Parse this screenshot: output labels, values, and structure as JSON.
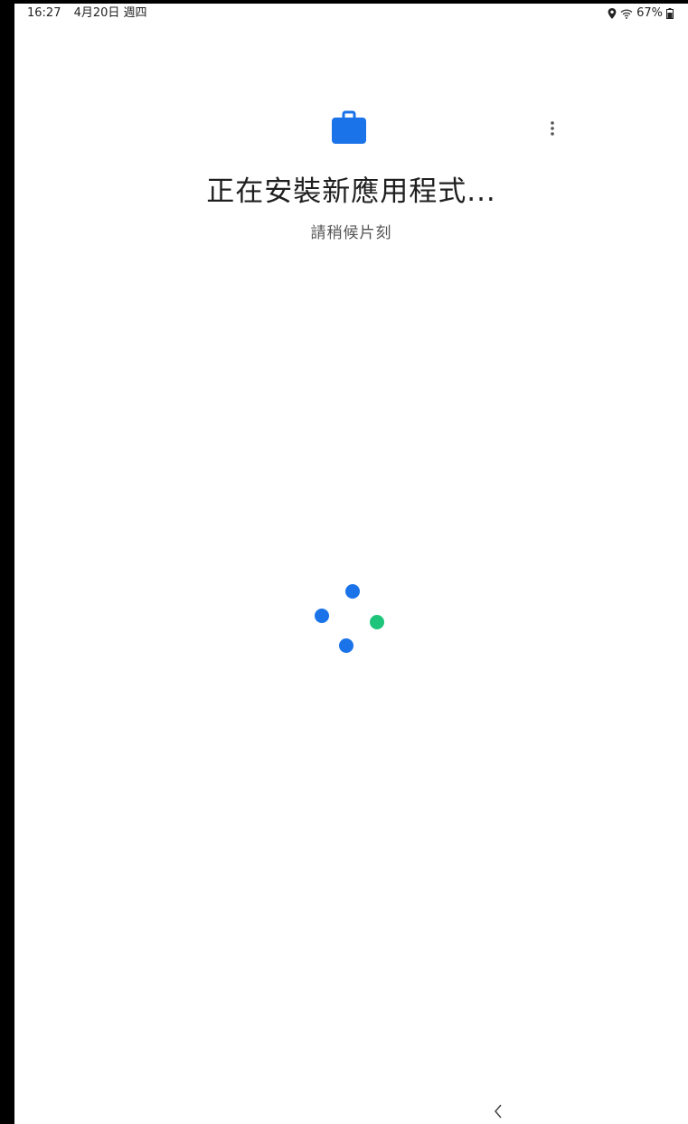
{
  "status_bar": {
    "time": "16:27",
    "date": "4月20日 週四",
    "battery": "67%",
    "icons": [
      "location-icon",
      "wifi-icon",
      "battery-icon"
    ]
  },
  "header": {
    "app_icon": "briefcase-icon",
    "menu_icon": "more-vert-icon"
  },
  "main": {
    "title": "正在安裝新應用程式...",
    "subtitle": "請稍候片刻"
  },
  "spinner": {
    "colors": [
      "#1a73e8",
      "#1a73e8",
      "#1e8e3e",
      "#1a73e8"
    ]
  },
  "colors": {
    "accent": "#1a73e8",
    "green": "#1ec47a"
  },
  "nav": {
    "back_icon": "chevron-left-icon"
  }
}
